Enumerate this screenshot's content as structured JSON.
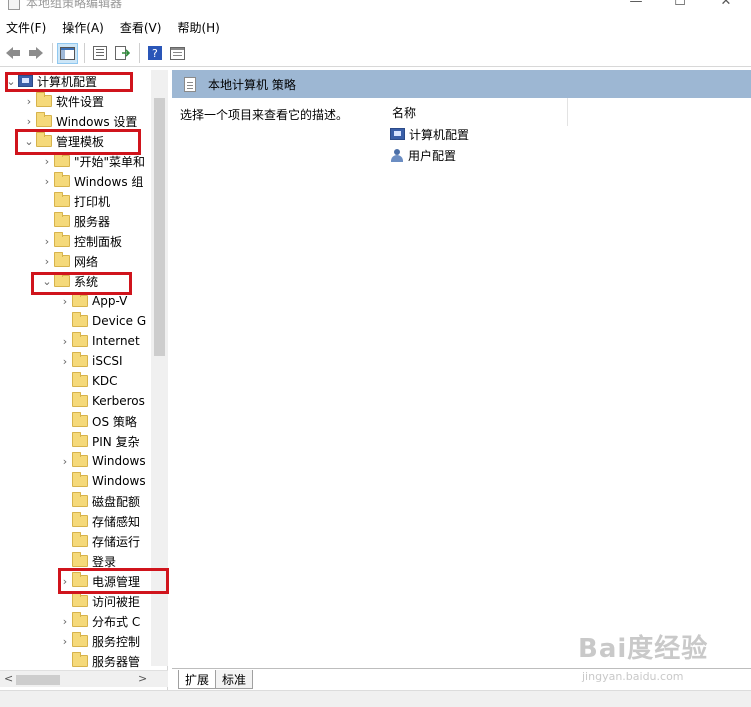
{
  "window": {
    "title": "本地组策略编辑器",
    "minimize": "—",
    "maximize": "☐",
    "close": "✕"
  },
  "menu": [
    "文件(F)",
    "操作(A)",
    "查看(V)",
    "帮助(H)"
  ],
  "tree": [
    {
      "label": "计算机配置",
      "icon": "computer-icon",
      "chevron": "expanded"
    },
    {
      "label": "软件设置",
      "icon": "folder-icon",
      "chevron": "collapsed"
    },
    {
      "label": "Windows 设置",
      "icon": "folder-icon",
      "chevron": "collapsed"
    },
    {
      "label": "管理模板",
      "icon": "folder-icon",
      "chevron": "expanded"
    },
    {
      "label": "\"开始\"菜单和",
      "icon": "folder-icon",
      "chevron": "collapsed"
    },
    {
      "label": "Windows 组",
      "icon": "folder-icon",
      "chevron": "collapsed"
    },
    {
      "label": "打印机",
      "icon": "folder-icon",
      "chevron": "none"
    },
    {
      "label": "服务器",
      "icon": "folder-icon",
      "chevron": "none"
    },
    {
      "label": "控制面板",
      "icon": "folder-icon",
      "chevron": "collapsed"
    },
    {
      "label": "网络",
      "icon": "folder-icon",
      "chevron": "collapsed"
    },
    {
      "label": "系统",
      "icon": "folder-icon",
      "chevron": "expanded"
    },
    {
      "label": "App-V",
      "icon": "folder-icon",
      "chevron": "collapsed"
    },
    {
      "label": "Device G",
      "icon": "folder-icon",
      "chevron": "none"
    },
    {
      "label": "Internet",
      "icon": "folder-icon",
      "chevron": "collapsed"
    },
    {
      "label": "iSCSI",
      "icon": "folder-icon",
      "chevron": "collapsed"
    },
    {
      "label": "KDC",
      "icon": "folder-icon",
      "chevron": "none"
    },
    {
      "label": "Kerberos",
      "icon": "folder-icon",
      "chevron": "none"
    },
    {
      "label": "OS 策略",
      "icon": "folder-icon",
      "chevron": "none"
    },
    {
      "label": "PIN 复杂",
      "icon": "folder-icon",
      "chevron": "none"
    },
    {
      "label": "Windows",
      "icon": "folder-icon",
      "chevron": "collapsed"
    },
    {
      "label": "Windows",
      "icon": "folder-icon",
      "chevron": "none"
    },
    {
      "label": "磁盘配额",
      "icon": "folder-icon",
      "chevron": "none"
    },
    {
      "label": "存储感知",
      "icon": "folder-icon",
      "chevron": "none"
    },
    {
      "label": "存储运行",
      "icon": "folder-icon",
      "chevron": "none"
    },
    {
      "label": "登录",
      "icon": "folder-icon",
      "chevron": "none"
    },
    {
      "label": "电源管理",
      "icon": "folder-icon",
      "chevron": "collapsed"
    },
    {
      "label": "访问被拒",
      "icon": "folder-icon",
      "chevron": "none"
    },
    {
      "label": "分布式 C",
      "icon": "folder-icon",
      "chevron": "collapsed"
    },
    {
      "label": "服务控制",
      "icon": "folder-icon",
      "chevron": "collapsed"
    },
    {
      "label": "服务器管",
      "icon": "folder-icon",
      "chevron": "none"
    }
  ],
  "right_pane": {
    "header_title": "本地计算机 策略",
    "description": "选择一个项目来查看它的描述。",
    "column_name": "名称",
    "items": [
      {
        "label": "计算机配置",
        "icon": "computer-icon"
      },
      {
        "label": "用户配置",
        "icon": "user-icon"
      }
    ]
  },
  "tabs": [
    "扩展",
    "标准"
  ],
  "watermark": {
    "main": "Bai度经验",
    "sub": "jingyan.baidu.com"
  },
  "colors": {
    "highlight": "#d0141c",
    "header": "#9db7d3"
  }
}
